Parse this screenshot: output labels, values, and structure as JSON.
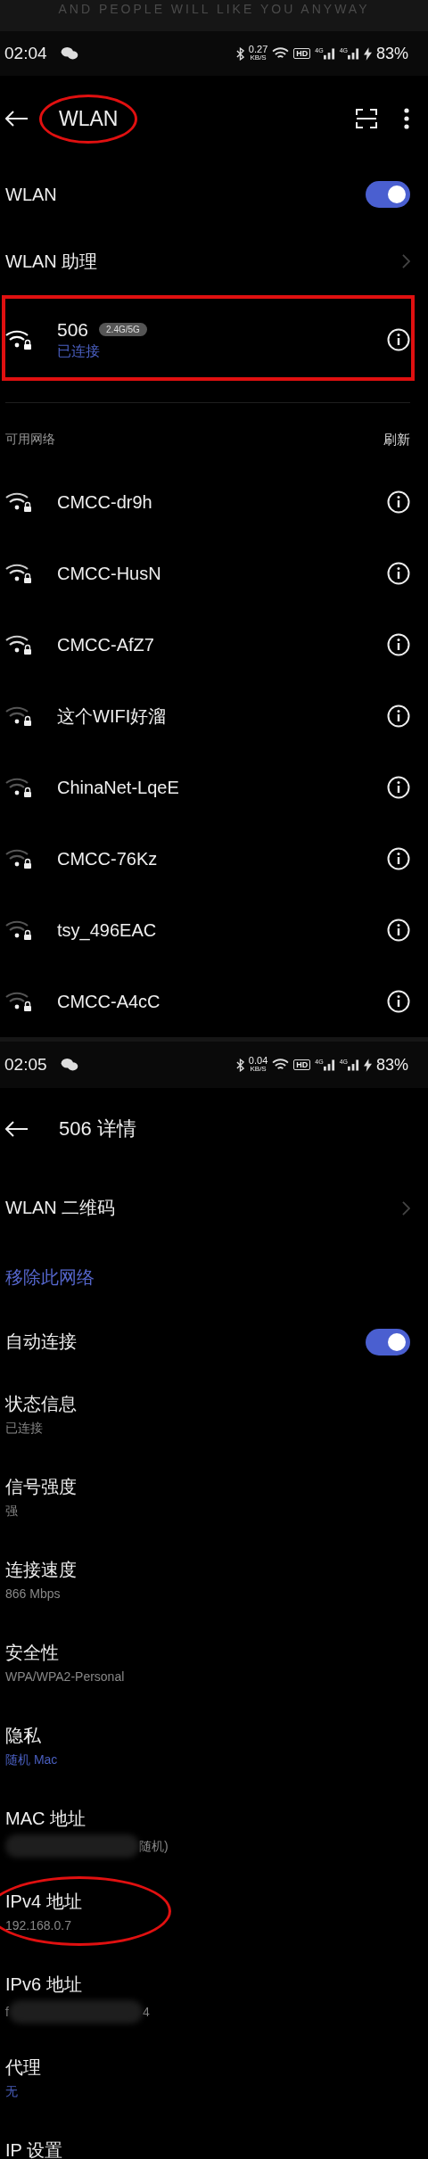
{
  "banner": {
    "text": "AND PEOPLE WILL LIKE YOU ANYWAY"
  },
  "screens": [
    {
      "status_bar": {
        "time": "02:04",
        "speed_value": "0.27",
        "speed_unit": "KB/S",
        "hd": "HD",
        "networks": [
          "4G",
          "4G"
        ],
        "battery": "83%"
      },
      "app_bar": {
        "title": "WLAN",
        "annotated": true
      },
      "wlan_switch": {
        "label": "WLAN",
        "on": true
      },
      "assistant": {
        "label": "WLAN 助理"
      },
      "connected": {
        "name": "506",
        "band": "2.4G/5G",
        "status": "已连接",
        "annotated": true
      },
      "section": {
        "label": "可用网络",
        "action": "刷新"
      },
      "networks": [
        {
          "name": "CMCC-dr9h",
          "strong": true
        },
        {
          "name": "CMCC-HusN",
          "strong": true
        },
        {
          "name": "CMCC-AfZ7",
          "strong": true
        },
        {
          "name": "这个WIFI好溜",
          "strong": false
        },
        {
          "name": "ChinaNet-LqeE",
          "strong": false
        },
        {
          "name": "CMCC-76Kz",
          "strong": false
        },
        {
          "name": "tsy_496EAC",
          "strong": false
        },
        {
          "name": "CMCC-A4cC",
          "strong": false
        }
      ]
    },
    {
      "status_bar": {
        "time": "02:05",
        "speed_value": "0.04",
        "speed_unit": "KB/S",
        "hd": "HD",
        "networks": [
          "4G",
          "4G"
        ],
        "battery": "83%"
      },
      "app_bar": {
        "title": "506 详情"
      },
      "qr_row": {
        "label": "WLAN 二维码"
      },
      "remove_link": {
        "label": "移除此网络"
      },
      "auto_connect": {
        "label": "自动连接",
        "on": true
      },
      "details": [
        {
          "title": "状态信息",
          "kind": "plain",
          "value": "已连接"
        },
        {
          "title": "信号强度",
          "kind": "plain",
          "value": "强"
        },
        {
          "title": "连接速度",
          "kind": "plain",
          "value": "866 Mbps"
        },
        {
          "title": "安全性",
          "kind": "plain",
          "value": "WPA/WPA2-Personal"
        },
        {
          "title": "隐私",
          "kind": "accent",
          "value": "随机 Mac"
        },
        {
          "title": "MAC 地址",
          "kind": "redacted",
          "parts": [
            {
              "kind": "blur"
            },
            {
              "kind": "text",
              "text": "随机)"
            }
          ]
        },
        {
          "title": "IPv4 地址",
          "kind": "plain",
          "value": "192.168.0.7",
          "annotated": true
        },
        {
          "title": "IPv6 地址",
          "kind": "redacted",
          "parts": [
            {
              "kind": "text",
              "text": "f"
            },
            {
              "kind": "blur"
            },
            {
              "kind": "text",
              "text": "4"
            }
          ]
        },
        {
          "title": "代理",
          "kind": "accent",
          "value": "无"
        },
        {
          "title": "IP 设置",
          "kind": "title_only"
        }
      ]
    }
  ]
}
